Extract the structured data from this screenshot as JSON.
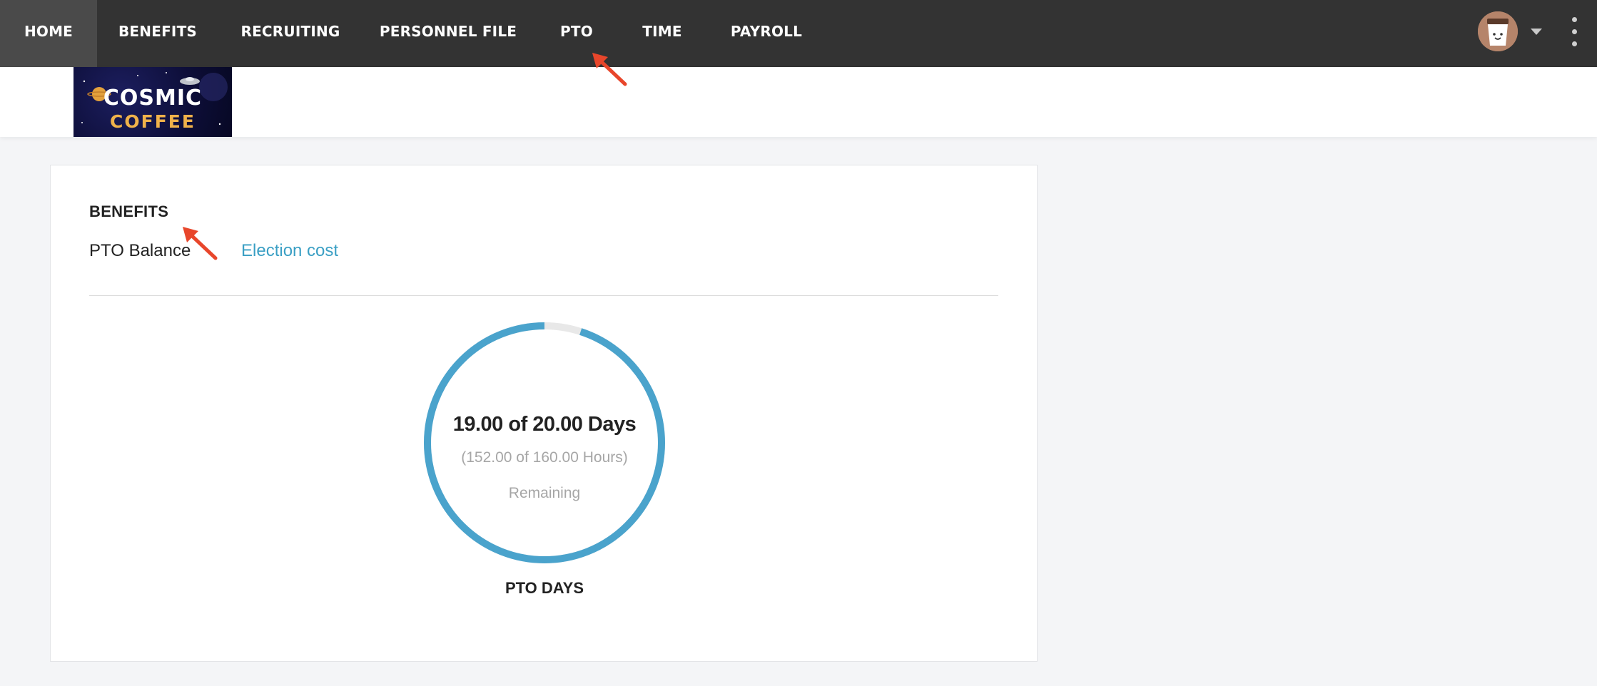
{
  "nav": {
    "items": [
      {
        "label": "HOME",
        "active": true
      },
      {
        "label": "BENEFITS",
        "active": false
      },
      {
        "label": "RECRUITING",
        "active": false
      },
      {
        "label": "PERSONNEL FILE",
        "active": false
      },
      {
        "label": "PTO",
        "active": false
      },
      {
        "label": "TIME",
        "active": false
      },
      {
        "label": "PAYROLL",
        "active": false
      }
    ],
    "user_menu": {
      "avatar_icon": "coffee-cup-avatar-icon",
      "caret_icon": "chevron-down-icon",
      "more_icon": "vertical-dots-icon"
    }
  },
  "logo": {
    "line1": "COSMIC",
    "line2": "COFFEE"
  },
  "benefits": {
    "title": "BENEFITS",
    "tabs": [
      {
        "label": "PTO Balance",
        "active": true
      },
      {
        "label": "Election cost",
        "active": false
      }
    ]
  },
  "pto": {
    "used_days": 19.0,
    "total_days": 20.0,
    "main_text": "19.00 of 20.00 Days",
    "hours_text": "(152.00 of 160.00 Hours)",
    "remaining_label": "Remaining",
    "caption": "PTO DAYS",
    "remaining_fraction": 0.95
  },
  "colors": {
    "nav_bg": "#333333",
    "accent": "#4aa3cc",
    "link": "#3a9fc4",
    "track": "#e8e8e8",
    "annotation_arrow": "#e8462b"
  }
}
